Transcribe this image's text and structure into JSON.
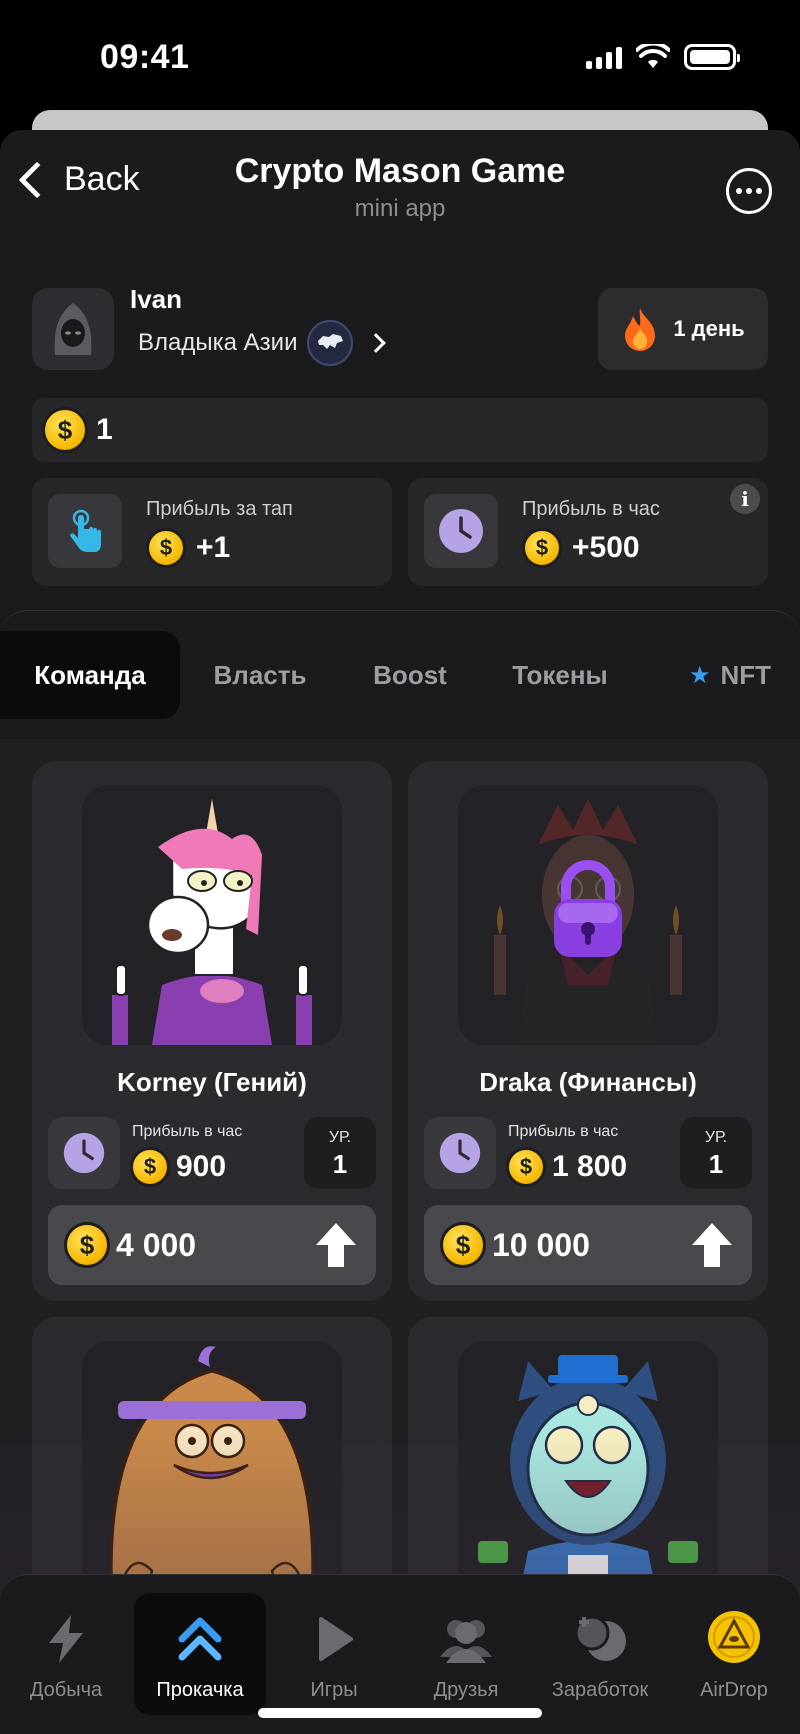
{
  "status_bar": {
    "time": "09:41"
  },
  "header": {
    "back_label": "Back",
    "title": "Crypto Mason Game",
    "subtitle": "mini app",
    "more_icon": "ellipsis-icon"
  },
  "profile": {
    "name": "Ivan",
    "rank": "Владыка Азии",
    "streak": "1 день"
  },
  "balance": {
    "value": "1"
  },
  "stats": {
    "tap": {
      "label": "Прибыль за тап",
      "value": "+1"
    },
    "hour": {
      "label": "Прибыль в час",
      "value": "+500",
      "info": "i"
    }
  },
  "tabs": [
    "Команда",
    "Власть",
    "Boost",
    "Токены",
    "NFT"
  ],
  "active_tab": "Команда",
  "cards": [
    {
      "name": "Korney (Гений)",
      "profit_label": "Прибыль в час",
      "profit": "900",
      "level_label": "УР.",
      "level": "1",
      "price": "4 000",
      "locked": false
    },
    {
      "name": "Draka (Финансы)",
      "profit_label": "Прибыль в час",
      "profit": "1 800",
      "level_label": "УР.",
      "level": "1",
      "price": "10 000",
      "locked": true
    }
  ],
  "bottom_nav": [
    {
      "label": "Добыча",
      "icon": "lightning-icon"
    },
    {
      "label": "Прокачка",
      "icon": "chevrons-up-icon"
    },
    {
      "label": "Игры",
      "icon": "play-icon"
    },
    {
      "label": "Друзья",
      "icon": "friends-icon"
    },
    {
      "label": "Заработок",
      "icon": "coins-icon"
    },
    {
      "label": "AirDrop",
      "icon": "airdrop-coin-icon"
    }
  ],
  "active_nav": "Прокачка",
  "colors": {
    "accent_gold": "#f5b700",
    "nav_active_blue": "#3a9cf0",
    "lock_purple": "#8a3fe0"
  }
}
